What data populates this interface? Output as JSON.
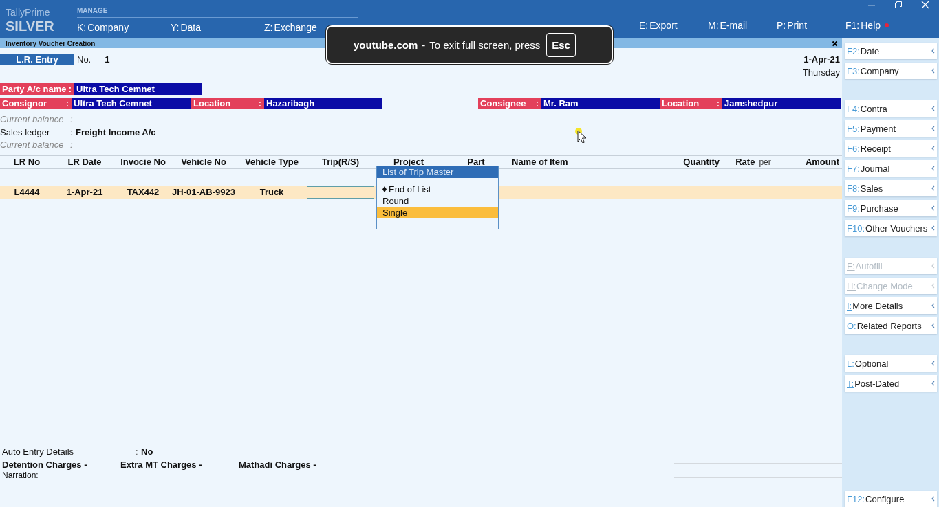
{
  "app": {
    "product": "TallyPrime",
    "edition": "SILVER"
  },
  "menu": {
    "heading": "MANAGE",
    "items": [
      {
        "key": "K:",
        "label": "Company"
      },
      {
        "key": "Y:",
        "label": "Data"
      },
      {
        "key": "Z:",
        "label": "Exchange"
      }
    ]
  },
  "top_actions": [
    {
      "key": "E:",
      "label": "Export",
      "alert": false
    },
    {
      "key": "M:",
      "label": "E-mail",
      "alert": false
    },
    {
      "key": "P:",
      "label": "Print",
      "alert": false
    },
    {
      "key": "F1:",
      "label": "Help",
      "alert": true
    }
  ],
  "screen_title": "Inventory Voucher Creation",
  "voucher": {
    "type": "L.R. Entry",
    "number_label": "No.",
    "number": "1",
    "date": "1-Apr-21",
    "day": "Thursday"
  },
  "party": {
    "label": "Party A/c name",
    "colon": ":",
    "value": "Ultra Tech Cemnet"
  },
  "fields": [
    {
      "label": "Consignor",
      "colon": ":",
      "value": "Ultra Tech Cemnet"
    },
    {
      "label": "Location",
      "colon": ":",
      "value": "Hazaribagh"
    },
    {
      "label": "Consignee",
      "colon": ":",
      "value": "Mr. Ram"
    },
    {
      "label": "Location",
      "colon": ":",
      "value": "Jamshedpur"
    }
  ],
  "info_lines": [
    {
      "label": "Current balance",
      "colon": ":",
      "kind": "muted"
    },
    {
      "label": "Sales ledger",
      "colon": ":",
      "value": "Freight Income A/c",
      "kind": "normal"
    },
    {
      "label": "Current balance",
      "colon": ":",
      "kind": "muted"
    }
  ],
  "table": {
    "columns": [
      {
        "label": "LR No"
      },
      {
        "label": "LR Date"
      },
      {
        "label": "Invocie No"
      },
      {
        "label": "Vehicle No"
      },
      {
        "label": "Vehicle Type"
      },
      {
        "label": "Trip(R/S)"
      },
      {
        "label": "Project"
      },
      {
        "label": "Part"
      },
      {
        "label": "Name of Item"
      },
      {
        "label": "Quantity"
      },
      {
        "label": "Rate",
        "unit": "per"
      },
      {
        "label": "Amount"
      }
    ],
    "rows": [
      {
        "selected": true,
        "cells": [
          "L4444",
          "1-Apr-21",
          "TAX442",
          "JH-01-AB-9923",
          "Truck"
        ]
      }
    ]
  },
  "dropdown": {
    "title": "List of Trip Master",
    "items": [
      {
        "label": "End of List",
        "kind": "end",
        "selected": false
      },
      {
        "label": "Round",
        "kind": "option",
        "selected": false
      },
      {
        "label": "Single",
        "kind": "option",
        "selected": true
      }
    ]
  },
  "footer": {
    "auto_entry": {
      "label": "Auto Entry Details",
      "colon": ":",
      "value": "No"
    },
    "charges": [
      "Detention Charges -",
      "Extra MT Charges -",
      "Mathadi Charges -"
    ],
    "narration": "Narration:"
  },
  "side_groups": [
    [
      {
        "key": "F2:",
        "label": "Date",
        "kind": "fkey",
        "disabled": false
      },
      {
        "key": "F3:",
        "label": "Company",
        "kind": "fkey",
        "disabled": false
      }
    ],
    [
      {
        "key": "F4:",
        "label": "Contra",
        "kind": "fkey",
        "disabled": false
      },
      {
        "key": "F5:",
        "label": "Payment",
        "kind": "fkey",
        "disabled": false
      },
      {
        "key": "F6:",
        "label": "Receipt",
        "kind": "fkey",
        "disabled": false
      },
      {
        "key": "F7:",
        "label": "Journal",
        "kind": "fkey",
        "disabled": false
      },
      {
        "key": "F8:",
        "label": "Sales",
        "kind": "fkey",
        "disabled": false
      },
      {
        "key": "F9:",
        "label": "Purchase",
        "kind": "fkey",
        "disabled": false
      },
      {
        "key": "F10:",
        "label": "Other Vouchers",
        "kind": "fkey",
        "disabled": false
      }
    ],
    [
      {
        "key": "F:",
        "label": "Autofill",
        "kind": "letter",
        "disabled": true
      },
      {
        "key": "H:",
        "label": "Change Mode",
        "kind": "letter",
        "disabled": true
      },
      {
        "key": "I:",
        "label": "More Details",
        "kind": "letter",
        "disabled": false
      },
      {
        "key": "O:",
        "label": "Related Reports",
        "kind": "letter",
        "disabled": false
      }
    ],
    [
      {
        "key": "L:",
        "label": "Optional",
        "kind": "letter",
        "disabled": false
      },
      {
        "key": "T:",
        "label": "Post-Dated",
        "kind": "letter",
        "disabled": false
      }
    ],
    [
      {
        "key": "F12:",
        "label": "Configure",
        "kind": "fkey",
        "disabled": false
      }
    ]
  ],
  "fullscreen_notice": {
    "site": "youtube.com",
    "separator": "-",
    "message": "To exit full screen, press",
    "key": "Esc"
  }
}
